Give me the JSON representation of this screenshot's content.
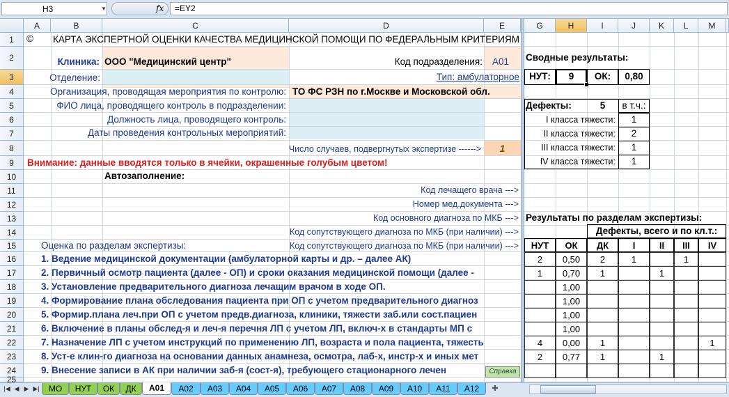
{
  "formula_bar": {
    "name_box": "H3",
    "fx": "fx",
    "formula": "=EY2"
  },
  "columns": [
    "A",
    "B",
    "C",
    "D",
    "E",
    "G",
    "H",
    "I",
    "J",
    "K",
    "L",
    "M"
  ],
  "rows": [
    "1",
    "2",
    "3",
    "4",
    "5",
    "6",
    "7",
    "8",
    "9",
    "10",
    "11",
    "12",
    "13",
    "14",
    "15",
    "16",
    "17",
    "18",
    "19",
    "20",
    "21",
    "22",
    "23",
    "24",
    "25"
  ],
  "sheet": {
    "copyright": "©",
    "title": "КАРТА ЭКСПЕРТНОЙ ОЦЕНКИ КАЧЕСТВА МЕДИЦИНСКОЙ ПОМОЩИ ПО ФЕДЕРАЛЬНЫМ КРИТЕРИЯМ",
    "clinic_label": "Клиника:",
    "clinic_value": "ООО \"Медицинский центр\"",
    "subdiv_label": "Код подразделения:",
    "subdiv_value": "А01",
    "dept_label": "Отделение:",
    "type_label": "Тип: амбулаторное",
    "org_label": "Организация, проводящая мероприятия по контролю:",
    "org_value": "ТО ФС РЗН по г.Москве и Московской обл.",
    "fio_label": "ФИО лица, проводящего контроль в подразделении:",
    "position_label": "Должность лица, проводящего контроль:",
    "dates_label": "Даты проведения контрольных мероприятий:",
    "cases_label": "Число случаев, подвергнутых экспертизе ------>",
    "cases_value": "1",
    "warning": "Внимание: данные вводятся только в ячейки, окрашенные голубым цветом!",
    "autofill_label": "Автозаполнение:",
    "doctor_code": "Код лечащего врача --->",
    "doc_number": "Номер мед.документа --->",
    "main_diag": "Код основного диагноза по МКБ --->",
    "concomitant_diag_14": "Код сопутствующего диагноза по МКБ (при наличии) --->",
    "concomitant_diag_15": "Код сопутствующего диагноза по МКБ (при наличии) --->",
    "sections_label": "Оценка по разделам экспертизы:",
    "items": [
      "1. Ведение медицинской документации (амбулаторной карты и др. – далее АК)",
      "2. Первичный осмотр пациента (далее - ОП) и сроки оказания медицинской помощи (далее -",
      "3. Установление предварительного диагноза лечащим врачом в ходе ОП.",
      "4. Формирование плана обследования пациента при ОП с учетом предварительного диагноз",
      "5. Формир.плана леч.при ОП с  учетом предв.диагноза, клиники, тяжести заб.или сост.пациен",
      "6. Включение в планы обслед-я и леч-я перечня ЛП с учетом ЛП, включ-х в стандарты МП с",
      "7. Назначение ЛП с учетом инструкций по применению ЛП, возраста и пола пациента, тяжесть",
      "8. Уст-е клин-го диагноза на основании данных анамнеза, осмотра, лаб-х, инстр-х и иных мет",
      "9. Внесение записи в АК при наличии заб-я (сост-я), требующего стационарного лечен"
    ],
    "help_button": "Справка"
  },
  "summary": {
    "title": "Сводные результаты:",
    "nut_label": "НУТ:",
    "nut_value": "9",
    "ok_label": "ОК:",
    "ok_value": "0,80",
    "defects_label": "Дефекты:",
    "defects_value": "5",
    "incl_label": "в т.ч.:",
    "classes": [
      {
        "label": "I класса тяжести:",
        "value": "1"
      },
      {
        "label": "II класса тяжести:",
        "value": "2"
      },
      {
        "label": "III класса тяжести:",
        "value": "1"
      },
      {
        "label": "IV класса тяжести:",
        "value": "1"
      }
    ],
    "results_title": "Результаты по разделам экспертизы:",
    "defects_header": "Дефекты, всего и по кл.т.:",
    "table_headers": [
      "НУТ",
      "ОК",
      "ДК",
      "I",
      "II",
      "III",
      "IV"
    ],
    "table_rows": [
      [
        "2",
        "0,50",
        "2",
        "1",
        "",
        "1",
        ""
      ],
      [
        "1",
        "0,70",
        "1",
        "",
        "1",
        "",
        ""
      ],
      [
        "",
        "1,00",
        "",
        "",
        "",
        "",
        ""
      ],
      [
        "",
        "1,00",
        "",
        "",
        "",
        "",
        ""
      ],
      [
        "",
        "1,00",
        "",
        "",
        "",
        "",
        ""
      ],
      [
        "",
        "1,00",
        "",
        "",
        "",
        "",
        ""
      ],
      [
        "4",
        "0,00",
        "1",
        "",
        "",
        "",
        "1"
      ],
      [
        "2",
        "0,77",
        "1",
        "",
        "1",
        "",
        ""
      ],
      [
        "",
        "",
        "",
        "",
        "",
        "",
        ""
      ]
    ]
  },
  "tabs": [
    {
      "label": "МО",
      "color": "#92d050"
    },
    {
      "label": "НУТ",
      "color": "#92d050"
    },
    {
      "label": "ОК",
      "color": "#92d050"
    },
    {
      "label": "ДК",
      "color": "#92d050"
    },
    {
      "label": "А01",
      "color": "#ffffff"
    },
    {
      "label": "А02",
      "color": "#66ccff"
    },
    {
      "label": "А03",
      "color": "#66ccff"
    },
    {
      "label": "А04",
      "color": "#66ccff"
    },
    {
      "label": "А05",
      "color": "#66ccff"
    },
    {
      "label": "А06",
      "color": "#66ccff"
    },
    {
      "label": "А07",
      "color": "#66ccff"
    },
    {
      "label": "А08",
      "color": "#66ccff"
    },
    {
      "label": "А09",
      "color": "#66ccff"
    },
    {
      "label": "А10",
      "color": "#66ccff"
    },
    {
      "label": "А11",
      "color": "#66ccff"
    },
    {
      "label": "А12",
      "color": "#66ccff"
    }
  ],
  "colors": {
    "peach": "#fde9d9",
    "input_blue": "#daeef3",
    "orange": "#fcd5b4",
    "warning_red": "#e31c1c",
    "label_blue": "#1f3a93"
  }
}
